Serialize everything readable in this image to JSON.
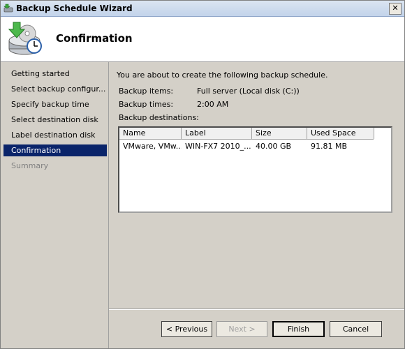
{
  "window": {
    "title": "Backup Schedule Wizard",
    "close_label": "✕"
  },
  "header": {
    "title": "Confirmation",
    "icon": "backup-drive-clock-icon"
  },
  "steps": [
    {
      "label": "Getting started",
      "state": "normal"
    },
    {
      "label": "Select backup configur...",
      "state": "normal"
    },
    {
      "label": "Specify backup time",
      "state": "normal"
    },
    {
      "label": "Select destination disk",
      "state": "normal"
    },
    {
      "label": "Label destination disk",
      "state": "normal"
    },
    {
      "label": "Confirmation",
      "state": "active"
    },
    {
      "label": "Summary",
      "state": "disabled"
    }
  ],
  "content": {
    "intro": "You are about to create the following backup schedule.",
    "backup_items_label": "Backup items:",
    "backup_items_value": "Full server (Local disk (C:))",
    "backup_times_label": "Backup times:",
    "backup_times_value": "2:00 AM",
    "destinations_label": "Backup destinations:",
    "columns": [
      "Name",
      "Label",
      "Size",
      "Used Space"
    ],
    "rows": [
      [
        "VMware, VMw...",
        "WIN-FX7 2010_...",
        "40.00 GB",
        "91.81 MB"
      ]
    ]
  },
  "buttons": {
    "previous": "< Previous",
    "next": "Next >",
    "finish": "Finish",
    "cancel": "Cancel"
  }
}
